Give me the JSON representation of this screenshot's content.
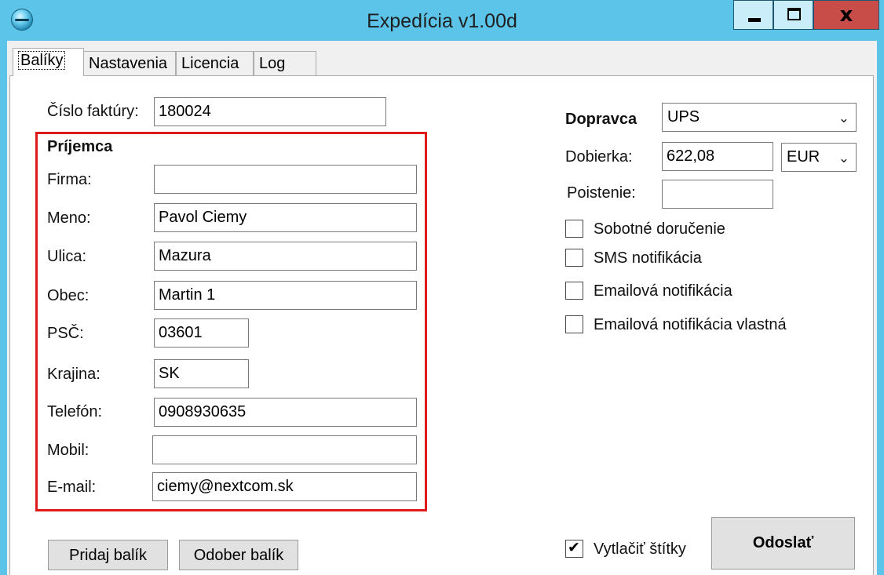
{
  "window": {
    "title": "Expedícia v1.00d",
    "close_glyph": "x"
  },
  "tabs": [
    {
      "label": "Balíky"
    },
    {
      "label": "Nastavenia"
    },
    {
      "label": "Licencia"
    },
    {
      "label": "Log"
    }
  ],
  "invoice": {
    "label": "Číslo faktúry:",
    "value": "180024"
  },
  "recipient": {
    "heading": "Príjemca",
    "firma": {
      "label": "Firma:",
      "value": ""
    },
    "meno": {
      "label": "Meno:",
      "value": "Pavol Ciemy"
    },
    "ulica": {
      "label": "Ulica:",
      "value": "Mazura"
    },
    "obec": {
      "label": "Obec:",
      "value": "Martin 1"
    },
    "psc": {
      "label": "PSČ:",
      "value": "03601"
    },
    "krajina": {
      "label": "Krajina:",
      "value": "SK"
    },
    "telefon": {
      "label": "Telefón:",
      "value": "0908930635"
    },
    "mobil": {
      "label": "Mobil:",
      "value": ""
    },
    "email": {
      "label": "E-mail:",
      "value": "ciemy@nextcom.sk"
    }
  },
  "shipping": {
    "carrier_label": "Dopravca",
    "carrier_value": "UPS",
    "cod_label": "Dobierka:",
    "cod_value": "622,08",
    "currency_value": "EUR",
    "insurance_label": "Poistenie:",
    "insurance_value": ""
  },
  "options": [
    {
      "label": "Sobotné doručenie",
      "checked": false
    },
    {
      "label": "SMS notifikácia",
      "checked": false
    },
    {
      "label": "Emailová notifikácia",
      "checked": false
    },
    {
      "label": "Emailová notifikácia vlastná",
      "checked": false
    }
  ],
  "buttons": {
    "add_package": "Pridaj balík",
    "remove_package": "Odober balík",
    "send": "Odoslať"
  },
  "print_labels": {
    "label": "Vytlačiť štítky",
    "checked": true
  },
  "colors": {
    "titlebar": "#5bc4e8",
    "close_button": "#c84d49",
    "highlight_border": "#e01919"
  },
  "icons": {
    "app": "globe-app-icon",
    "chevron": "chevron-down-icon",
    "check": "checkmark-icon"
  }
}
